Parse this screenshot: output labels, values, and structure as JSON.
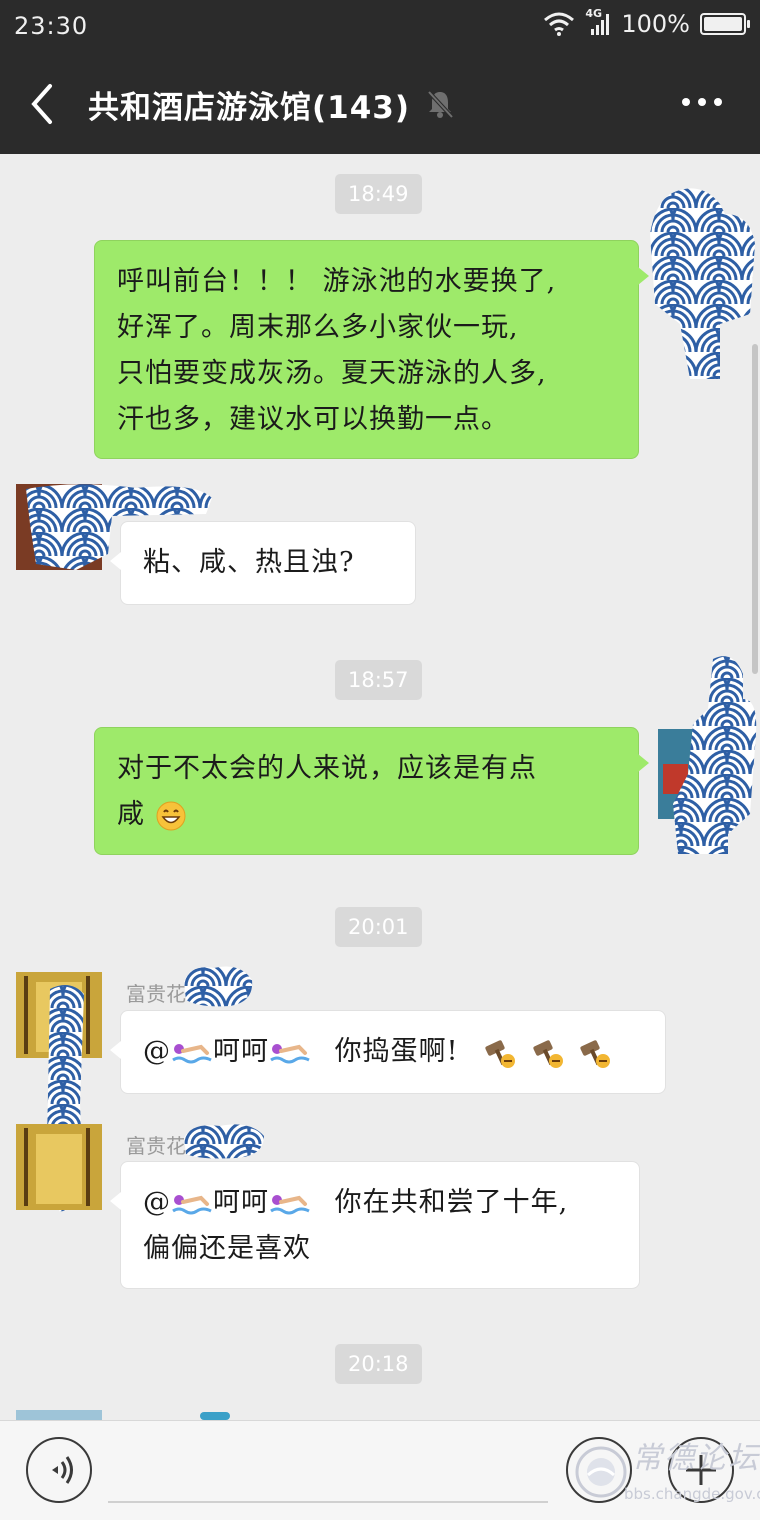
{
  "status_bar": {
    "time": "23:30",
    "network": "4G",
    "battery_text": "100%",
    "battery_level": 1.0
  },
  "header": {
    "title": "共和酒店游泳馆(143)",
    "back_icon": "chevron-left-icon",
    "mute_icon": "bell-muted-icon",
    "more_icon": "more-dots-icon"
  },
  "messages": [
    {
      "type": "time",
      "text": "18:49"
    },
    {
      "type": "me",
      "lines": [
        "呼叫前台！！！ 游泳池的水要换了,",
        "好浑了。周末那么多小家伙一玩,",
        "只怕要变成灰汤。夏天游泳的人多,",
        "汗也多，建议水可以换勤一点。"
      ]
    },
    {
      "type": "other",
      "text": "粘、咸、热且浊?"
    },
    {
      "type": "time",
      "text": "18:57"
    },
    {
      "type": "me",
      "lines": [
        "对于不太会的人来说，应该是有点",
        "咸"
      ],
      "emoji": "grinning-face-icon"
    },
    {
      "type": "time",
      "text": "20:01"
    },
    {
      "type": "other",
      "sender": "富贵花",
      "mention": "@",
      "laugh": "呵呵",
      "text": "你捣蛋啊!",
      "emoji": "swimmer-icon",
      "trailing_emoji": "hammer-icon"
    },
    {
      "type": "other",
      "sender": "富贵花",
      "mention": "@",
      "laugh": "呵呵",
      "lines": [
        "你在共和尝了十年,",
        "偏偏还是喜欢"
      ],
      "emoji": "swimmer-icon"
    },
    {
      "type": "time",
      "text": "20:18"
    }
  ],
  "footer": {
    "voice_icon": "voice-icon",
    "emoji_icon": "emoji-icon",
    "plus_icon": "plus-icon",
    "watermark_title": "常德论坛",
    "watermark_url": "bbs.changde.gov.cn"
  },
  "colors": {
    "header_bg": "#2b2b2b",
    "chat_bg": "#ededed",
    "my_bubble": "#9eea6a",
    "other_bubble": "#ffffff",
    "redaction_blue": "#2e5fa5"
  }
}
